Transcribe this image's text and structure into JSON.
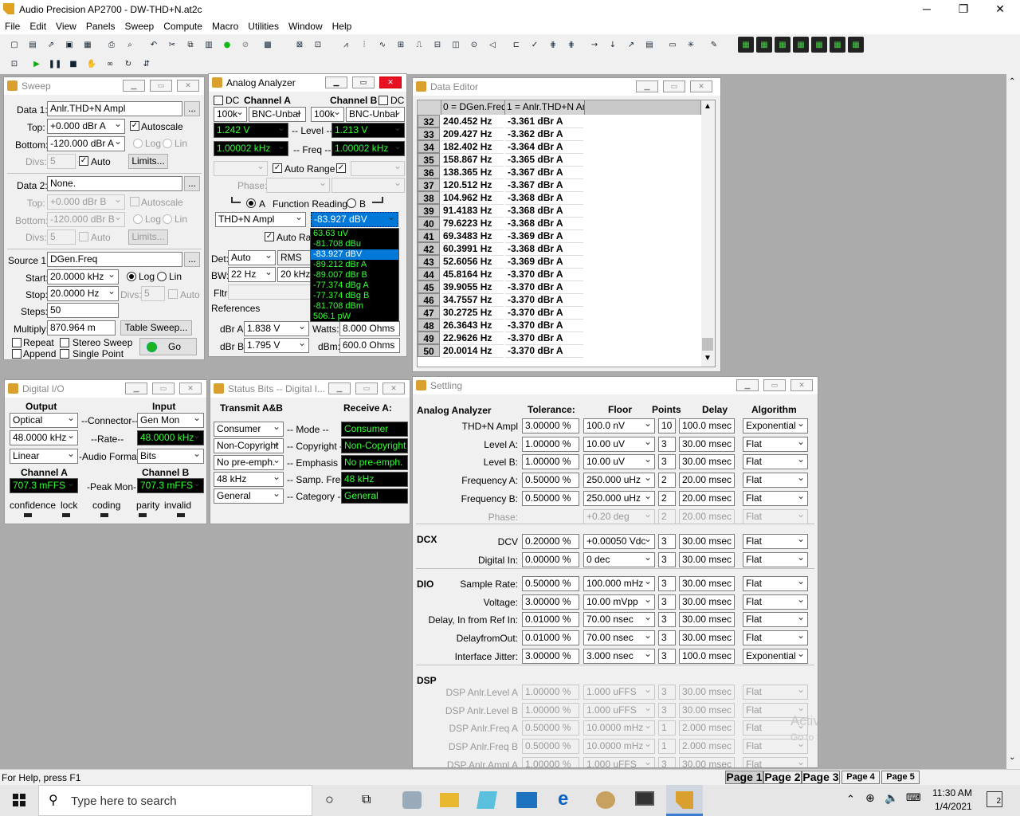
{
  "app": {
    "title": "Audio Precision AP2700 - DW-THD+N.at2c",
    "min": "─",
    "max": "❐",
    "close": "✕"
  },
  "menu": [
    "File",
    "Edit",
    "View",
    "Panels",
    "Sweep",
    "Compute",
    "Macro",
    "Utilities",
    "Window",
    "Help"
  ],
  "sweep": {
    "title": "Sweep",
    "data1_label": "Data 1:",
    "data1": "Anlr.THD+N Ampl",
    "top_label": "Top:",
    "top": "+0.000  dBr A",
    "autoscale": "Autoscale",
    "bottom_label": "Bottom:",
    "bottom": "-120.000 dBr A",
    "log": "Log",
    "lin": "Lin",
    "divs_label": "Divs:",
    "divs": "5",
    "auto": "Auto",
    "limits": "Limits...",
    "data2_label": "Data 2:",
    "data2": "None.",
    "top2": "+0.000  dBr B",
    "bottom2": "-120.000 dBr B",
    "divs2": "5",
    "source1_label": "Source 1:",
    "source1": "DGen.Freq",
    "start_label": "Start:",
    "start": "20.0000 kHz",
    "stop_label": "Stop:",
    "stop": "20.0000  Hz",
    "divs3": "5",
    "steps_label": "Steps:",
    "steps": "50",
    "multiply_label": "Multiply:",
    "multiply": "870.964 m",
    "table_sweep": "Table Sweep...",
    "repeat": "Repeat",
    "stereo": "Stereo Sweep",
    "append": "Append",
    "single": "Single Point",
    "go": "Go",
    "ellipsis": "..."
  },
  "analyzer": {
    "title": "Analog Analyzer",
    "dc": "DC",
    "chA": "Channel A",
    "chB": "Channel B",
    "imp_a": "100k",
    "conn_a": "BNC-Unbal",
    "imp_b": "100k",
    "conn_b": "BNC-Unbal",
    "level_a": "1.242  V",
    "level_label": "-- Level --",
    "level_b": "1.213  V",
    "freq_a": "1.00002 kHz",
    "freq_label": "-- Freq --",
    "freq_b": "1.00002 kHz",
    "autorange": "Auto Range",
    "phase": "Phase:",
    "func_a": "A",
    "func_label": "Function Reading",
    "func_b": "B",
    "func": "THD+N Ampl",
    "reading": "-83.927  dBV",
    "autorange2": "Auto Range",
    "det_label": "Det:",
    "det": "Auto",
    "rms": "RMS",
    "bw_label": "BW:",
    "bw": "22 Hz",
    "bw2": "20 kHz",
    "fltr": "Fltr:",
    "refs": "References",
    "dbra_label": "dBr A:",
    "dbra": "1.838   V",
    "dbrb_label": "dBr B:",
    "dbrb": "1.795   V",
    "watts_label": "Watts:",
    "watts": "8.000    Ohms",
    "dbm_label": "dBm:",
    "dbm": "600.0   Ohms"
  },
  "reading_units": [
    "63.63   uV",
    "-81.708  dBu",
    "-83.927  dBV",
    "-89.212  dBr A",
    "-89.007  dBr B",
    "-77.374  dBg A",
    "-77.374  dBg B",
    "-81.708  dBm",
    "506.1   pW"
  ],
  "editor": {
    "title": "Data Editor",
    "col1": "0 = DGen.Freq",
    "col2": "1 = Anlr.THD+N Ampl",
    "rows": [
      {
        "n": "32",
        "f": "240.452  Hz",
        "v": "-3.361   dBr A"
      },
      {
        "n": "33",
        "f": "209.427  Hz",
        "v": "-3.362   dBr A"
      },
      {
        "n": "34",
        "f": "182.402  Hz",
        "v": "-3.364   dBr A"
      },
      {
        "n": "35",
        "f": "158.867  Hz",
        "v": "-3.365   dBr A"
      },
      {
        "n": "36",
        "f": "138.365  Hz",
        "v": "-3.367   dBr A"
      },
      {
        "n": "37",
        "f": "120.512  Hz",
        "v": "-3.367   dBr A"
      },
      {
        "n": "38",
        "f": "104.962  Hz",
        "v": "-3.368   dBr A"
      },
      {
        "n": "39",
        "f": "91.4183  Hz",
        "v": "-3.368   dBr A"
      },
      {
        "n": "40",
        "f": "79.6223  Hz",
        "v": "-3.368   dBr A"
      },
      {
        "n": "41",
        "f": "69.3483  Hz",
        "v": "-3.369   dBr A"
      },
      {
        "n": "42",
        "f": "60.3991  Hz",
        "v": "-3.368   dBr A"
      },
      {
        "n": "43",
        "f": "52.6056  Hz",
        "v": "-3.369   dBr A"
      },
      {
        "n": "44",
        "f": "45.8164  Hz",
        "v": "-3.370   dBr A"
      },
      {
        "n": "45",
        "f": "39.9055  Hz",
        "v": "-3.370   dBr A"
      },
      {
        "n": "46",
        "f": "34.7557  Hz",
        "v": "-3.370   dBr A"
      },
      {
        "n": "47",
        "f": "30.2725  Hz",
        "v": "-3.370   dBr A"
      },
      {
        "n": "48",
        "f": "26.3643  Hz",
        "v": "-3.370   dBr A"
      },
      {
        "n": "49",
        "f": "22.9626  Hz",
        "v": "-3.370   dBr A"
      },
      {
        "n": "50",
        "f": "20.0014  Hz",
        "v": "-3.370   dBr A"
      }
    ]
  },
  "dio": {
    "title": "Digital I/O",
    "output": "Output",
    "input": "Input",
    "out_conn": "Optical",
    "conn_label": "--Connector--",
    "in_conn": "Gen Mon",
    "out_rate": "48.0000 kHz",
    "rate_label": "--Rate--",
    "in_rate": "48.0000 kHz",
    "out_fmt": "Linear",
    "fmt_label": "-Audio Format-",
    "in_fmt": "Bits",
    "chA": "Channel A",
    "chB": "Channel B",
    "peakA": "707.3   mFFS",
    "peak_label": "-Peak Mon-",
    "peakB": "707.3   mFFS",
    "flags": [
      "confidence",
      "lock",
      "coding",
      "parity",
      "invalid"
    ]
  },
  "status": {
    "title": "Status Bits -- Digital I...",
    "transmit": "Transmit A&B",
    "receive": "Receive A:",
    "rows": [
      {
        "tx": "Consumer",
        "label": "-- Mode --",
        "rx": "Consumer"
      },
      {
        "tx": "Non-Copyright",
        "label": "-- Copyright --",
        "rx": "Non-Copyright"
      },
      {
        "tx": "No pre-emph.",
        "label": "-- Emphasis --",
        "rx": "No pre-emph."
      },
      {
        "tx": "48 kHz",
        "label": "-- Samp. Freq",
        "rx": "48 kHz"
      },
      {
        "tx": "General",
        "label": "-- Category --",
        "rx": "General"
      }
    ]
  },
  "settling": {
    "title": "Settling",
    "h_tol": "Tolerance:",
    "h_floor": "Floor",
    "h_points": "Points",
    "h_delay": "Delay",
    "h_algo": "Algorithm",
    "sections": [
      {
        "name": "Analog Analyzer",
        "rows": [
          {
            "label": "THD+N Ampl",
            "tol": "3.00000  %",
            "floor": "100.0   nV",
            "pts": "10",
            "delay": "100.0  msec",
            "algo": "Exponential",
            "dis": false
          },
          {
            "label": "Level A:",
            "tol": "1.00000  %",
            "floor": "10.00   uV",
            "pts": "3",
            "delay": "30.00  msec",
            "algo": "Flat",
            "dis": false
          },
          {
            "label": "Level B:",
            "tol": "1.00000  %",
            "floor": "10.00   uV",
            "pts": "3",
            "delay": "30.00  msec",
            "algo": "Flat",
            "dis": false
          },
          {
            "label": "Frequency A:",
            "tol": "0.50000  %",
            "floor": "250.000 uHz",
            "pts": "2",
            "delay": "20.00  msec",
            "algo": "Flat",
            "dis": false
          },
          {
            "label": "Frequency B:",
            "tol": "0.50000  %",
            "floor": "250.000 uHz",
            "pts": "2",
            "delay": "20.00  msec",
            "algo": "Flat",
            "dis": false
          },
          {
            "label": "Phase:",
            "tol": "",
            "floor": "+0.20    deg",
            "pts": "2",
            "delay": "20.00  msec",
            "algo": "Flat",
            "dis": true
          }
        ]
      },
      {
        "name": "DCX",
        "rows": [
          {
            "label": "DCV",
            "tol": "0.20000  %",
            "floor": "+0.00050 Vdc",
            "pts": "3",
            "delay": "30.00  msec",
            "algo": "Flat",
            "dis": false
          },
          {
            "label": "Digital In:",
            "tol": "0.00000  %",
            "floor": "0        dec",
            "pts": "3",
            "delay": "30.00  msec",
            "algo": "Flat",
            "dis": false
          }
        ]
      },
      {
        "name": "DIO",
        "rows": [
          {
            "label": "Sample Rate:",
            "tol": "0.50000  %",
            "floor": "100.000 mHz",
            "pts": "3",
            "delay": "30.00  msec",
            "algo": "Flat",
            "dis": false
          },
          {
            "label": "Voltage:",
            "tol": "3.00000  %",
            "floor": "10.00   mVpp",
            "pts": "3",
            "delay": "30.00  msec",
            "algo": "Flat",
            "dis": false
          },
          {
            "label": "Delay, In from Ref In:",
            "tol": "0.01000  %",
            "floor": "70.00   nsec",
            "pts": "3",
            "delay": "30.00  msec",
            "algo": "Flat",
            "dis": false
          },
          {
            "label": "DelayfromOut:",
            "tol": "0.01000  %",
            "floor": "70.00   nsec",
            "pts": "3",
            "delay": "30.00  msec",
            "algo": "Flat",
            "dis": false
          },
          {
            "label": "Interface Jitter:",
            "tol": "3.00000  %",
            "floor": "3.000   nsec",
            "pts": "3",
            "delay": "100.0  msec",
            "algo": "Exponential",
            "dis": false
          }
        ]
      },
      {
        "name": "DSP",
        "rows": [
          {
            "label": "DSP Anlr.Level A",
            "tol": "1.00000  %",
            "floor": "1.000   uFFS",
            "pts": "3",
            "delay": "30.00  msec",
            "algo": "Flat",
            "dis": true
          },
          {
            "label": "DSP Anlr.Level B",
            "tol": "1.00000  %",
            "floor": "1.000   uFFS",
            "pts": "3",
            "delay": "30.00  msec",
            "algo": "Flat",
            "dis": true
          },
          {
            "label": "DSP Anlr.Freq A",
            "tol": "0.50000  %",
            "floor": "10.0000 mHz",
            "pts": "1",
            "delay": "2.000  msec",
            "algo": "Flat",
            "dis": true
          },
          {
            "label": "DSP Anlr.Freq B",
            "tol": "0.50000  %",
            "floor": "10.0000 mHz",
            "pts": "1",
            "delay": "2.000  msec",
            "algo": "Flat",
            "dis": true
          },
          {
            "label": "DSP Anlr.Ampl A",
            "tol": "1.00000  %",
            "floor": "1.000   uFFS",
            "pts": "3",
            "delay": "30.00  msec",
            "algo": "Flat",
            "dis": true
          }
        ]
      }
    ],
    "watermark1": "Activate Windows",
    "watermark2": "Go to Settings to activate Windows."
  },
  "statusbar": {
    "help": "For Help, press F1",
    "pages": [
      "Page 1",
      "Page 2",
      "Page 3",
      "Page 4",
      "Page 5"
    ]
  },
  "taskbar": {
    "search": "Type here to search",
    "time": "11:30 AM",
    "date": "1/4/2021",
    "notif": "2"
  }
}
